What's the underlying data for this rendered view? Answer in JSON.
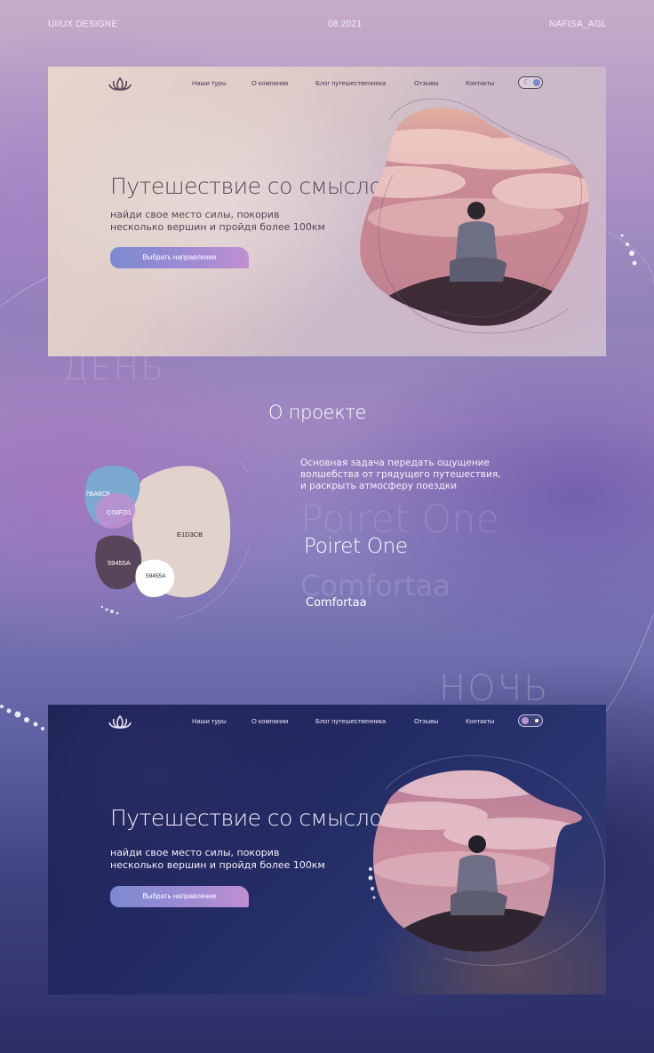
{
  "meta": {
    "left": "UI/UX DESIGNE",
    "center": "08.2021",
    "right": "NAFISA_AGL"
  },
  "deco": {
    "day_word": "ДЕНЬ",
    "night_word": "НОЧЬ"
  },
  "nav": {
    "items": [
      "Наши туры",
      "О компании",
      "Блог путешественника",
      "Отзывы",
      "Контакты"
    ]
  },
  "hero": {
    "title": "Путешествие со смыслом",
    "subtitle_line1": "найди свое место силы, покорив",
    "subtitle_line2": "несколько вершин и пройдя более 100км",
    "cta": "Выбрать направление"
  },
  "about": {
    "title": "О проекте",
    "text_line1": "Основная задача передать ощущение",
    "text_line2": "волшебства от грядущего путешествия,",
    "text_line3": "и раскрыть атмосферу поездки",
    "fonts": {
      "primary": "Poiret One",
      "secondary": "Comfortaa"
    },
    "palette": [
      {
        "label": "7BA8CF",
        "color": "#7BA8CF"
      },
      {
        "label": "C08FD1",
        "color": "#C08FD1"
      },
      {
        "label": "E1D3CB",
        "color": "#E1D3CB"
      },
      {
        "label": "59455A",
        "color": "#59455A"
      },
      {
        "label": "59455A",
        "color": "#FFFFFF"
      }
    ]
  },
  "colors": {
    "plum": "#59455A",
    "blue": "#7B8ACF",
    "lilac": "#C08FD1",
    "sand": "#E1D3CB",
    "night": "#1d2253"
  }
}
